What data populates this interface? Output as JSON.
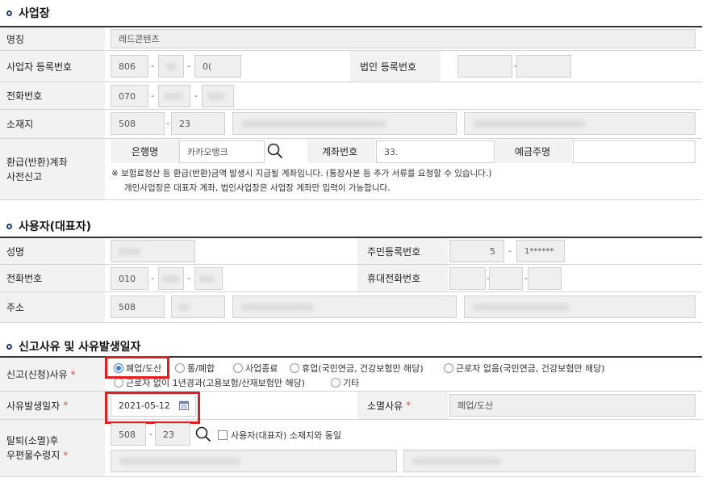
{
  "sections": {
    "business": "사업장",
    "owner": "사용자(대표자)",
    "report": "신고사유 및 사유발생일자"
  },
  "business": {
    "name_label": "명칭",
    "name_value": "레드콘텐츠",
    "regno_label": "사업자 등록번호",
    "regno_first": "806",
    "regno_third": "0(",
    "corpno_label": "법인 등록번호",
    "phone_label": "전화번호",
    "phone_first": "070",
    "address_label": "소재지",
    "addr_zip1": "508",
    "addr_zip2": "23",
    "refund_label_1": "환급(반환)계좌",
    "refund_label_2": "사전신고",
    "bank_label": "은행명",
    "bank_value": "카카오뱅크",
    "account_label": "계좌번호",
    "account_value": "33.",
    "holder_label": "예금주명",
    "notice_line1": "※ 보험료정산 등 환급(반환)금액 발생시 지급될 계좌입니다. (통장사본 등 추가 서류를 요청할 수 있습니다.)",
    "notice_line2": "개인사업장은 대표자 계좌, 법인사업장은 사업장 계좌만 입력이 가능합니다."
  },
  "owner": {
    "name_label": "성명",
    "rrn_label": "주민등록번호",
    "rrn_front": "5",
    "rrn_back": "1******",
    "phone_label": "전화번호",
    "phone_first": "010",
    "mobile_label": "휴대전화번호",
    "address_label": "주소",
    "addr_zip1": "508"
  },
  "report": {
    "reason_label": "신고(신청)사유",
    "reason_options": [
      "폐업/도산",
      "통/폐합",
      "사업종료",
      "휴업(국민연금, 건강보험만 해당)",
      "근로자 없음(국민연금, 건강보험만 해당)",
      "근로자 없이 1년경과(고용보험/산재보험만 해당)",
      "기타"
    ],
    "reason_selected": "폐업/도산",
    "date_label": "사유발생일자",
    "date_value": "2021-05-12",
    "cancel_reason_label": "소멸사유",
    "cancel_reason_value": "폐업/도산",
    "mail_label_1": "탈퇴(소멸)후",
    "mail_label_2": "우편물수령지",
    "mail_zip1": "508",
    "mail_zip2": "23",
    "same_as_owner": "사용자(대표자) 소재지와 동일"
  },
  "colors": {
    "highlight": "#e02020",
    "radio_accent": "#3a7bd5",
    "required": "#d9534f"
  }
}
